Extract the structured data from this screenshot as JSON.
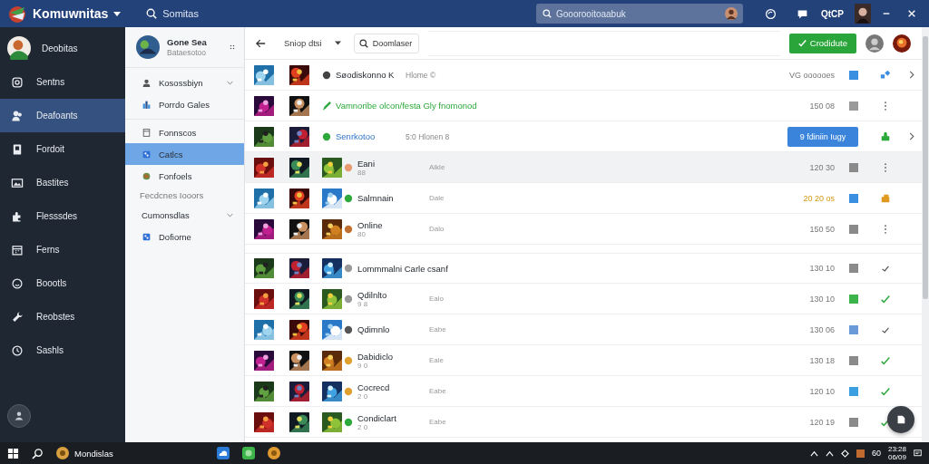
{
  "app": {
    "title": "Komuwnitas",
    "search_label": "Somitas",
    "search_placeholder": "Gooorooitoaabuk",
    "user_label": "QtCP"
  },
  "nav": [
    {
      "label": "Deobitas",
      "selected": false
    },
    {
      "label": "Sentns",
      "selected": false
    },
    {
      "label": "Deafoants",
      "selected": true
    },
    {
      "label": "Fordoit",
      "selected": false
    },
    {
      "label": "Bastites",
      "selected": false
    },
    {
      "label": "Flesssdes",
      "selected": false
    },
    {
      "label": "Ferns",
      "selected": false
    },
    {
      "label": "Boootls",
      "selected": false
    },
    {
      "label": "Reobstes",
      "selected": false
    },
    {
      "label": "Sashls",
      "selected": false
    }
  ],
  "panel": {
    "title": "Gone Sea",
    "subtitle": "Bataesotoo",
    "items": [
      {
        "label": "Kosossbiyn",
        "kind": "group",
        "selected": false
      },
      {
        "label": "Porrdo Gales",
        "kind": "item",
        "selected": false
      },
      {
        "label": "Fonnscos",
        "kind": "item",
        "selected": false
      },
      {
        "label": "Catlcs",
        "kind": "item",
        "selected": true
      },
      {
        "label": "Fonfoels",
        "kind": "item",
        "selected": false
      },
      {
        "label": "Fecdcnes Iooors",
        "kind": "heading",
        "selected": false
      },
      {
        "label": "Cumonsdlas",
        "kind": "group",
        "selected": false
      },
      {
        "label": "Dofiorne",
        "kind": "item",
        "selected": false
      }
    ]
  },
  "toolbar": {
    "filter": "Sniop dtsi",
    "search_placeholder": "Doomlaser",
    "action": "Crodidute"
  },
  "rows": [
    {
      "kind": "notice",
      "selected": false,
      "title": "Søodiskonno K",
      "meta": "Hlome ©",
      "time": "VG oooooes",
      "warning": false,
      "color": "#3b8fe0"
    },
    {
      "kind": "success",
      "selected": false,
      "title": "Vamnoribe olcon/festa Gly fnomonod",
      "time": "150 08",
      "warning": false,
      "color": "#9a9a9a"
    },
    {
      "kind": "link",
      "selected": false,
      "title": "Senrkotoo",
      "meta": "5:0 Hlonen 8",
      "button": "9 fdiniin Iugy"
    },
    {
      "kind": "media",
      "selected": true,
      "title": "Eani",
      "sub": "88",
      "tag": "Aikle",
      "time": "120 30",
      "warning": false,
      "color": "#8a8a8a"
    },
    {
      "kind": "media",
      "selected": false,
      "title": "Salmnain",
      "tag": "Dale",
      "time": "20 20 os",
      "warning": true,
      "color": "#3b8fe0"
    },
    {
      "kind": "media",
      "selected": false,
      "title": "Online",
      "sub": "80",
      "tag": "Dalo",
      "time": "150 50",
      "warning": false,
      "color": "#8a8a8a"
    },
    {
      "kind": "media",
      "selected": false,
      "title": "Lommmalni Carle csanf",
      "time": "130 10",
      "warning": false,
      "color": "#8a8a8a"
    },
    {
      "kind": "media",
      "selected": false,
      "title": "Qdilnlto",
      "sub": "9 8",
      "tag": "Ealo",
      "time": "130 10",
      "warning": false,
      "color": "#3cb44a"
    },
    {
      "kind": "media",
      "selected": false,
      "title": "Qdimnlo",
      "tag": "Eabe",
      "time": "130 06",
      "warning": false,
      "color": "#6a9ad8"
    },
    {
      "kind": "media",
      "selected": false,
      "title": "Dabidiclo",
      "sub": "9 0",
      "tag": "Eale",
      "time": "130 18",
      "warning": false,
      "color": "#8a8a8a"
    },
    {
      "kind": "media",
      "selected": false,
      "title": "Cocrecd",
      "sub": "2 0",
      "tag": "Eabe",
      "time": "120 10",
      "warning": false,
      "color": "#3ba0e0"
    },
    {
      "kind": "media",
      "selected": false,
      "title": "Condiclart",
      "sub": "2 0",
      "tag": "Eabe",
      "time": "120 19",
      "warning": false,
      "color": "#8a8a8a"
    }
  ],
  "taskbar": {
    "app": "Mondislas",
    "tray_text": "60",
    "clock_time": "23:28",
    "clock_date": "06/09"
  }
}
